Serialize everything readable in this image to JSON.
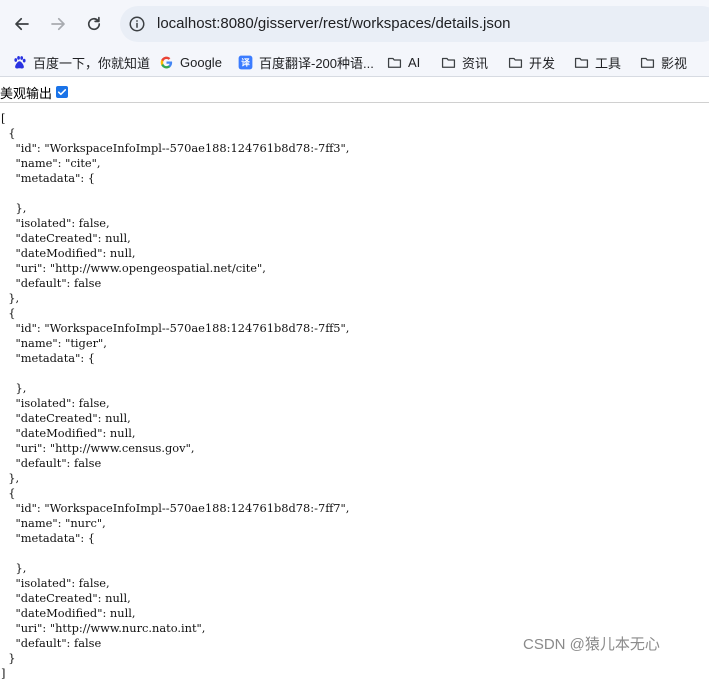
{
  "browser": {
    "url": "localhost:8080/gisserver/rest/workspaces/details.json",
    "bookmarks": [
      "百度一下，你就知道",
      "Google",
      "百度翻译-200种语...",
      "AI",
      "资讯",
      "开发",
      "工具",
      "影视"
    ],
    "bookmark_icons": [
      "baidu-paw-icon",
      "google-g-icon",
      "baidu-translate-icon",
      "folder-icon",
      "folder-icon",
      "folder-icon",
      "folder-icon",
      "folder-icon"
    ]
  },
  "pretty_print": {
    "label": "美观输出",
    "checked": true
  },
  "json_text": "[\n  {\n    \"id\": \"WorkspaceInfoImpl--570ae188:124761b8d78:-7ff3\",\n    \"name\": \"cite\",\n    \"metadata\": {\n\n    },\n    \"isolated\": false,\n    \"dateCreated\": null,\n    \"dateModified\": null,\n    \"uri\": \"http://www.opengeospatial.net/cite\",\n    \"default\": false\n  },\n  {\n    \"id\": \"WorkspaceInfoImpl--570ae188:124761b8d78:-7ff5\",\n    \"name\": \"tiger\",\n    \"metadata\": {\n\n    },\n    \"isolated\": false,\n    \"dateCreated\": null,\n    \"dateModified\": null,\n    \"uri\": \"http://www.census.gov\",\n    \"default\": false\n  },\n  {\n    \"id\": \"WorkspaceInfoImpl--570ae188:124761b8d78:-7ff7\",\n    \"name\": \"nurc\",\n    \"metadata\": {\n\n    },\n    \"isolated\": false,\n    \"dateCreated\": null,\n    \"dateModified\": null,\n    \"uri\": \"http://www.nurc.nato.int\",\n    \"default\": false\n  }\n]",
  "watermark": "CSDN @猿儿本无心",
  "colors": {
    "toolbar_bg": "#f4f6fb",
    "omnibox_bg": "#e9eef6",
    "checkbox": "#1a73e8",
    "baidu_blue": "#2932e1",
    "translate_blue": "#3b7cff"
  }
}
